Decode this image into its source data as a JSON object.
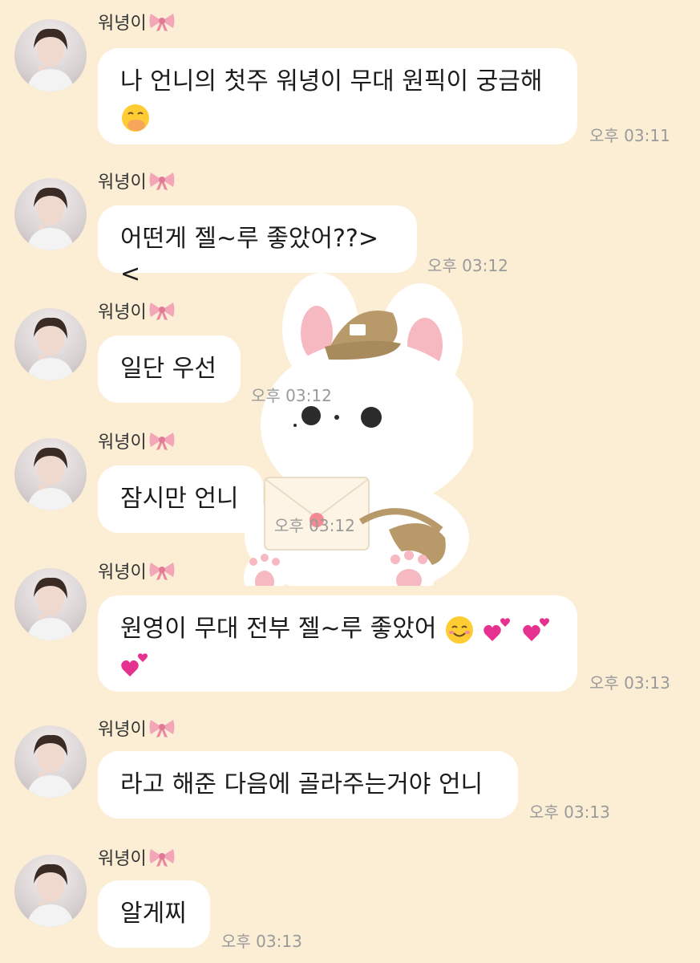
{
  "chat": {
    "sender_name": "워녕이",
    "messages": [
      {
        "text": "나 언니의 첫주 워녕이 무대 원픽이 궁금해",
        "time": "오후 03:11",
        "emoji": "hand-over-mouth-emoji"
      },
      {
        "text": "어떤게 젤~루 좋았어??><",
        "time": "오후 03:12"
      },
      {
        "text": "일단 우선",
        "time": "오후 03:12"
      },
      {
        "text": "잠시만 언니",
        "time": "오후 03:12"
      },
      {
        "text": "원영이 무대 전부 젤~루 좋았어",
        "time": "오후 03:13",
        "emoji": "smiling-face-and-hearts"
      },
      {
        "text": "라고 해준 다음에 골라주는거야 언니",
        "time": "오후 03:13"
      },
      {
        "text": "알게찌",
        "time": "오후 03:13"
      }
    ]
  },
  "icons": {
    "name_decoration": "pink-ribbon-icon",
    "background": "bunny-mail-carrier-sticker"
  },
  "colors": {
    "background": "#FBEED5",
    "bubble": "#FFFFFF",
    "timestamp": "#9A9A9A"
  }
}
